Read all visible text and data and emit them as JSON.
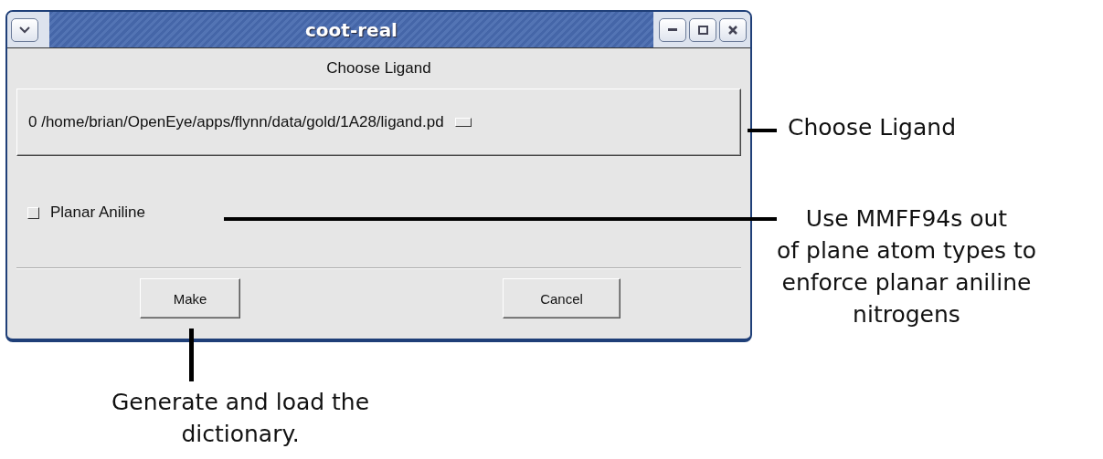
{
  "window": {
    "title": "coot-real"
  },
  "dialog_label": "Choose Ligand",
  "ligand_menu": {
    "value": "0 /home/brian/OpenEye/apps/flynn/data/gold/1A28/ligand.pd"
  },
  "options": [
    {
      "label": "Planar Aniline",
      "checked": false
    }
  ],
  "buttons": [
    "Make",
    "Cancel"
  ],
  "annotations": [
    {
      "lines": [
        "Choose Ligand"
      ]
    },
    {
      "lines": [
        "Use MMFF94s out",
        "of plane atom types to",
        "enforce planar aniline",
        "nitrogens"
      ]
    },
    {
      "lines": [
        "Generate and load the",
        "dictionary."
      ]
    }
  ]
}
